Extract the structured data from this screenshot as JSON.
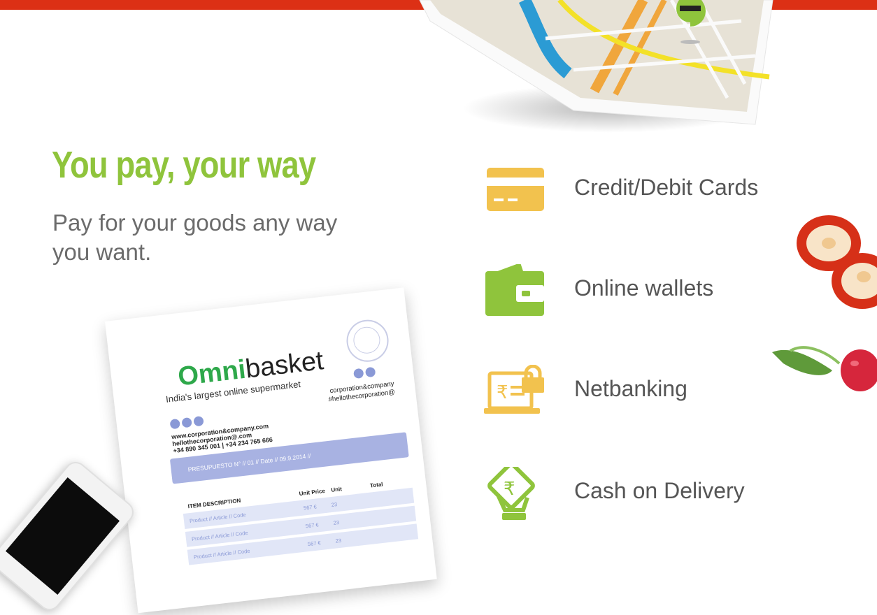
{
  "colors": {
    "banner": "#dc3015",
    "accent_green": "#8fc43c",
    "icon_yellow": "#f2c24e",
    "icon_green": "#8fc43c"
  },
  "hero": {
    "title": "You pay, your way",
    "subtitle": "Pay for your goods any way you want."
  },
  "methods": [
    {
      "icon": "credit-card-icon",
      "label": "Credit/Debit Cards"
    },
    {
      "icon": "wallet-icon",
      "label": "Online wallets"
    },
    {
      "icon": "netbanking-icon",
      "label": "Netbanking"
    },
    {
      "icon": "cash-on-delivery-icon",
      "label": "Cash on Delivery"
    }
  ],
  "invoice": {
    "brand_part1": "Omni",
    "brand_part2": "basket",
    "tagline": "India's largest online supermarket",
    "company": "corporation&company",
    "handle": "#hellothecorporation@",
    "website": "www.corporation&company.com",
    "email": "hellothecorporation@.com",
    "phones": "+34 890 345 001 | +34 234 765 666",
    "band": "PRESUPUESTO N° // 01 // Date // 09.9.2014 //",
    "col_description": "ITEM DESCRIPTION",
    "col_unit_price": "Unit Price",
    "col_unit": "Unit",
    "col_total": "Total",
    "rows": [
      {
        "desc": "Product // Article // Code",
        "price": "567 €",
        "unit": "23"
      },
      {
        "desc": "Product // Article // Code",
        "price": "567 €",
        "unit": "23"
      },
      {
        "desc": "Product // Article // Code",
        "price": "567 €",
        "unit": "23"
      }
    ]
  }
}
